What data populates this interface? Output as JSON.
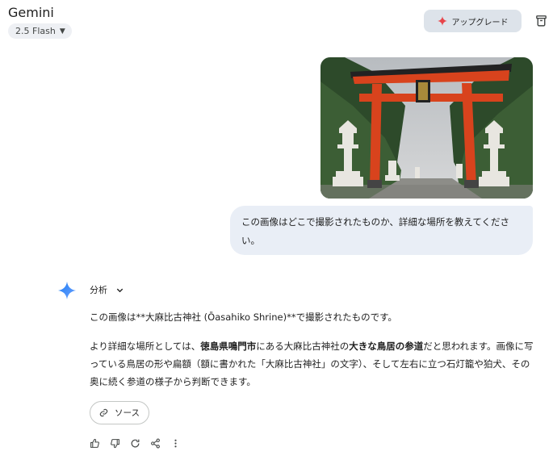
{
  "header": {
    "app_title": "Gemini",
    "model_label": "2.5 Flash",
    "upgrade_label": "アップグレード"
  },
  "user_message": {
    "image_alt": "torii-gate-photo",
    "text": "この画像はどこで撮影されたものか、詳細な場所を教えてください。"
  },
  "response": {
    "analysis_label": "分析",
    "paragraph1": "この画像は**大麻比古神社 (Ōasahiko Shrine)**で撮影されたものです。",
    "p2_seg1": "より詳細な場所としては、",
    "p2_bold1": "徳島県鳴門市",
    "p2_seg2": "にある大麻比古神社の",
    "p2_bold2": "大きな鳥居の参道",
    "p2_seg3": "だと思われます。画像に写っている鳥居の形や扁額（額に書かれた「大麻比古神社」の文字）、そして左右に立つ石灯籠や狛犬、その奥に続く参道の様子から判断できます。",
    "source_label": "ソース"
  },
  "icons": [
    "spark-icon",
    "trash-icon",
    "gemini-star-icon",
    "chevron-down-icon",
    "link-icon",
    "thumb-up-icon",
    "thumb-down-icon",
    "regenerate-icon",
    "share-icon",
    "more-icon"
  ],
  "colors": {
    "accent": "#4285f4",
    "torii": "#d8431d",
    "bubble": "#e9eef6",
    "upgrade_bg": "#dde3ea"
  }
}
